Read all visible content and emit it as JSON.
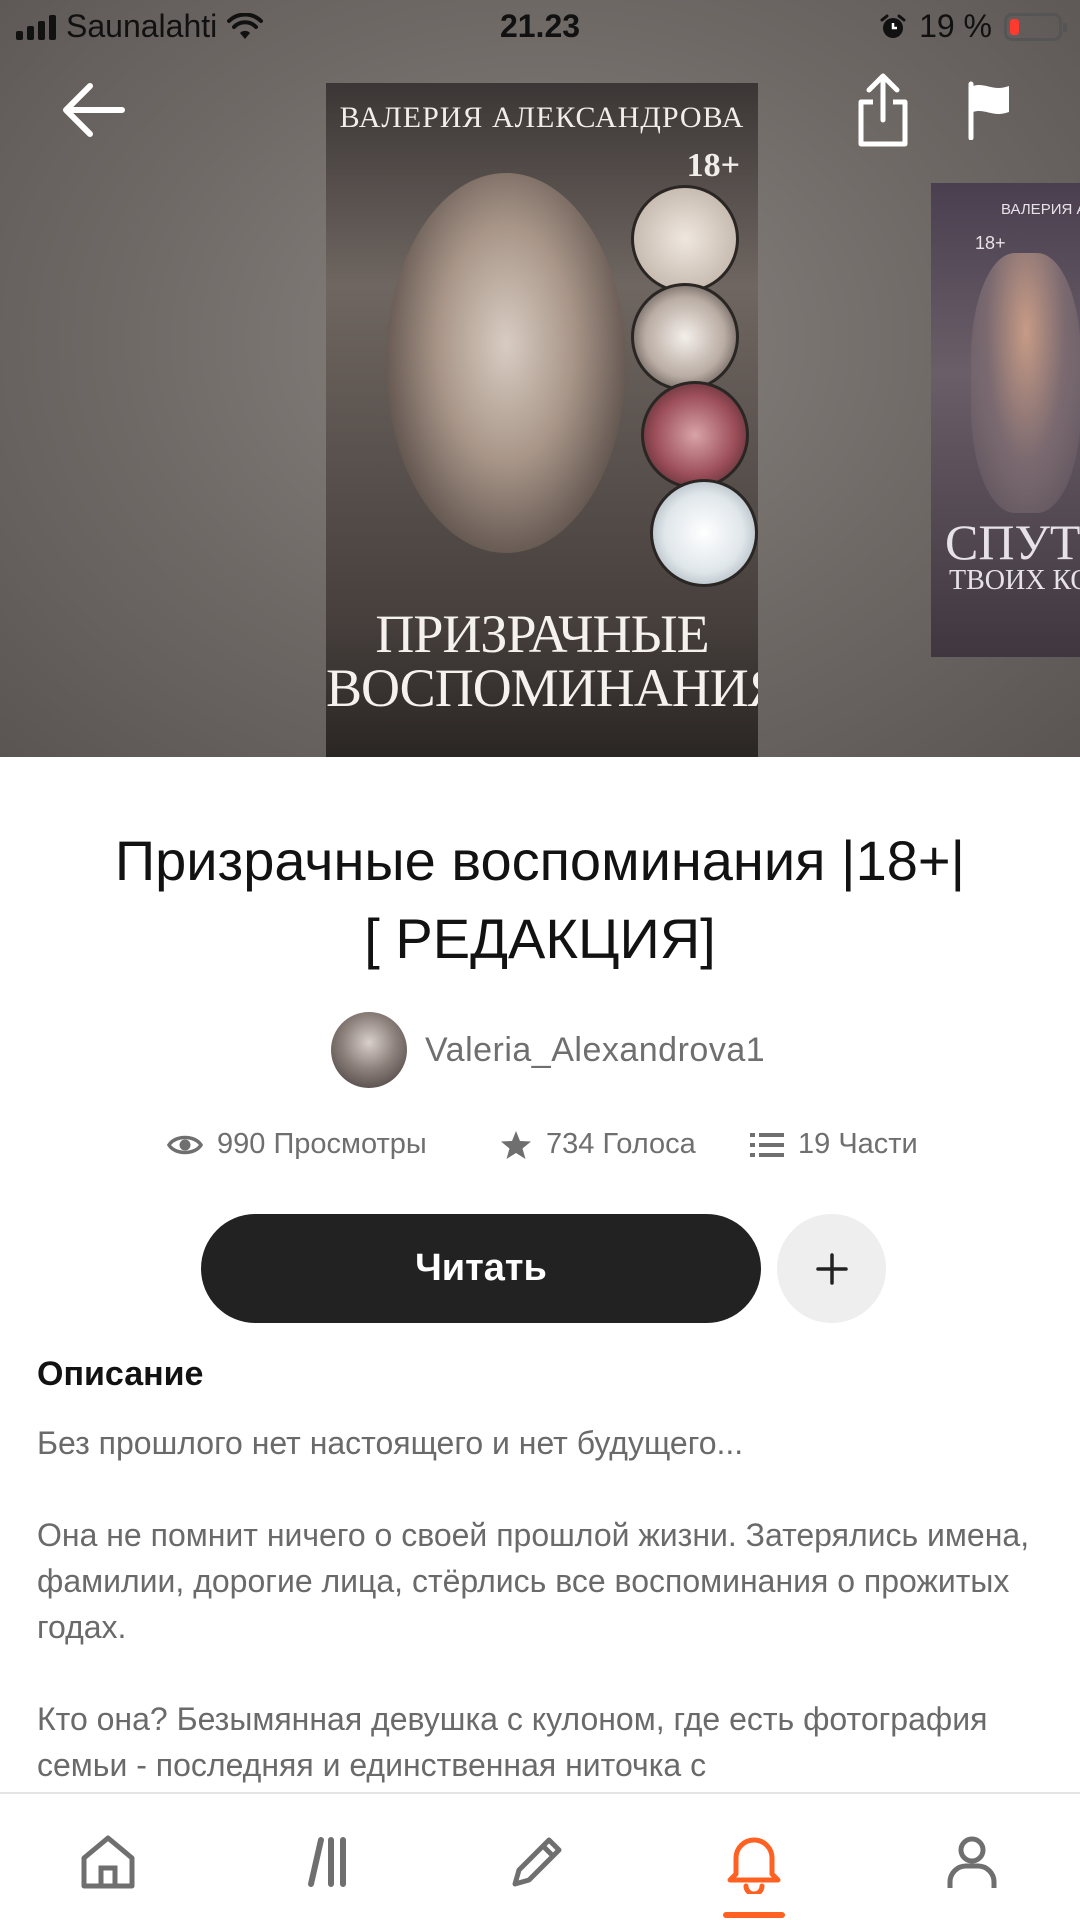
{
  "status_bar": {
    "carrier": "Saunalahti",
    "time": "21.23",
    "battery": "19 %",
    "battery_level": 0.19
  },
  "cover": {
    "author": "ВАЛЕРИЯ АЛЕКСАНДРОВА",
    "age": "18+",
    "title_line1": "ПРИЗРАЧНЫЕ",
    "title_line2": "ВОСПОМИНАНИЯ"
  },
  "next_cover": {
    "author": "ВАЛЕРИЯ АЛ",
    "age": "18+",
    "title": "СПУТ",
    "subtitle": "ТВОИХ КО"
  },
  "story": {
    "title_line1": "Призрачные воспоминания |18+|",
    "title_line2": "[ РЕДАКЦИЯ]",
    "author": "Valeria_Alexandrova1"
  },
  "stats": {
    "views": "990 Просмотры",
    "votes": "734 Голоса",
    "parts": "19 Части"
  },
  "actions": {
    "read_label": "Читать",
    "add_icon": "plus-icon"
  },
  "description": {
    "heading": "Описание",
    "p1": "Без прошлого нет настоящего и нет будущего...",
    "p2": " Она не помнит ничего о своей прошлой жизни. Затерялись имена,  фамилии, дорогие лица, стёрлись все воспоминания о прожитых годах.",
    "p3": " Кто она? Безымянная девушка с кулоном, где есть фотография семьи - последняя и единственная ниточка с"
  },
  "tabbar": {
    "items": [
      "home-icon",
      "library-icon",
      "write-icon",
      "notifications-icon",
      "profile-icon"
    ],
    "active": "notifications-icon",
    "accent": "#ff6122"
  }
}
